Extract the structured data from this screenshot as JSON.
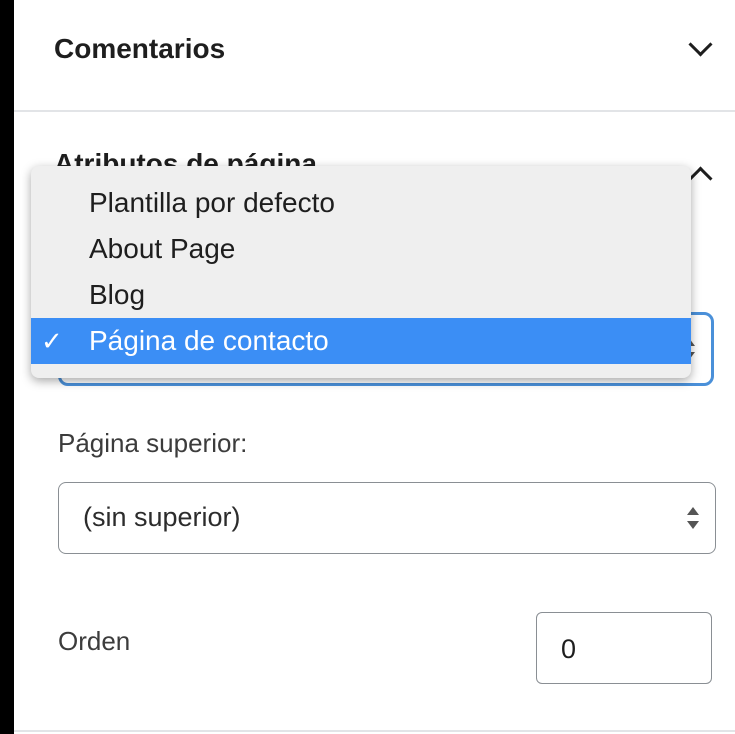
{
  "sections": {
    "comments": {
      "title": "Comentarios"
    },
    "page_attributes": {
      "title": "Atributos de página"
    }
  },
  "template_select": {
    "options": [
      "Plantilla por defecto",
      "About Page",
      "Blog",
      "Página de contacto"
    ],
    "selected": "Página de contacto",
    "checkmark": "✓"
  },
  "parent": {
    "label": "Página superior:",
    "value": "(sin superior)"
  },
  "order": {
    "label": "Orden",
    "value": "0"
  },
  "colors": {
    "accent": "#3b8ef5",
    "focus_border": "#4a90d9"
  }
}
